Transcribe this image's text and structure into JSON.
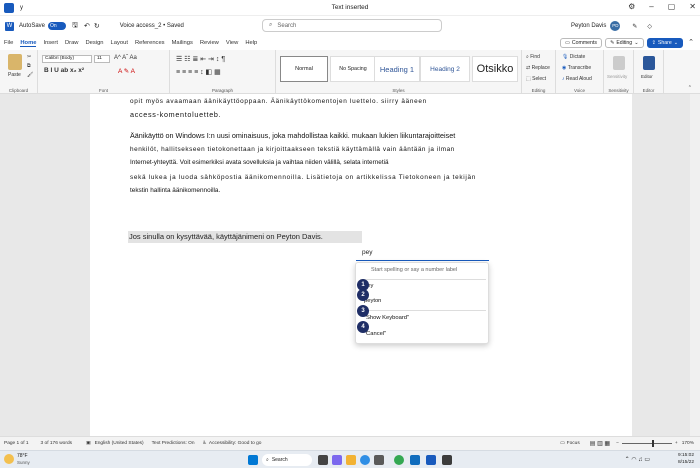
{
  "window": {
    "app_letter": "y",
    "title": "Text inserted"
  },
  "qat": {
    "autosave": "AutoSave",
    "toggle": "On",
    "doc_name": "Voice access_2 • Saved"
  },
  "search": {
    "placeholder": "Search"
  },
  "user": {
    "name": "Peyton Davis",
    "initials": "PD"
  },
  "tabs": [
    "File",
    "Home",
    "Insert",
    "Draw",
    "Design",
    "Layout",
    "References",
    "Mailings",
    "Review",
    "View",
    "Help"
  ],
  "tab_buttons": {
    "comments": "Comments",
    "editing": "Editing",
    "share": "Share"
  },
  "ribbon": {
    "clipboard": {
      "label": "Clipboard",
      "paste": "Paste"
    },
    "font": {
      "label": "Font",
      "name": "Calibri (Body)",
      "size": "11",
      "row2": "B I U ab x₂ x²",
      "row3": "A ✎ A"
    },
    "paragraph": {
      "label": "Paragraph"
    },
    "styles": {
      "label": "Styles",
      "items": [
        "Normal",
        "No Spacing",
        "Heading 1",
        "Heading 2",
        "Otsikko"
      ]
    },
    "editing": {
      "label": "Editing",
      "find": "Find",
      "replace": "Replace",
      "select": "Select"
    },
    "voice": {
      "label": "Voice",
      "dictate": "Dictate",
      "transcribe": "Transcribe",
      "read_aloud": "Read Aloud"
    },
    "sensitivity": {
      "label": "Sensitivity"
    },
    "editor": {
      "label": "Editor",
      "button": "Editor"
    }
  },
  "doc": {
    "line1": "opit myös avaamaan äänikäyttöoppaan. Äänikäyttökomentojen luettelo. siirry ääneen",
    "line2": "access-komentoluetteb.",
    "p2_l1": "Äänikäyttö on Windows I:n uusi ominaisuus, joka mahdollistaa kaikki. mukaan lukien liikuntarajoitteiset",
    "p2_l2": "henkilöt, hallitsekseen tietokonettaan ja kirjoittaakseen tekstiä käyttämällä vain ääntään ja ilman",
    "p2_l3": "Internet-yhteyttä. Voit esimerkiksi avata sovelluksia ja vaihtaa niiden välillä, selata internetiä",
    "p2_l4": "sekä lukea ja luoda sähköpostia äänikomennoilla. Lisätietoja on artikkelissa Tietokoneen ja tekijän",
    "p2_l5": "tekstin hallinta äänikomennoilla.",
    "highlight": "Jos sinulla on kysyttävää, käyttäjänimeni on Peyton Davis."
  },
  "voice_popup": {
    "input": "pey",
    "hint": "Start spelling or say a number label",
    "items": [
      {
        "n": "1",
        "label": "pey"
      },
      {
        "n": "2",
        "label": "peyton"
      },
      {
        "n": "3",
        "label": "\"Show Keyboard\""
      },
      {
        "n": "4",
        "label": "\"Cancel\""
      }
    ]
  },
  "status": {
    "page": "Page 1 of 1",
    "words": "3 of 176 words",
    "lang": "English (United States)",
    "predictions": "Text Predictions: On",
    "accessibility": "Accessibility: Good to go",
    "focus": "Focus",
    "zoom": "170%"
  },
  "taskbar": {
    "weather_temp": "78°F",
    "weather_desc": "Sunny",
    "search": "Search",
    "time": "9:15:02",
    "date": "8/15/22"
  }
}
